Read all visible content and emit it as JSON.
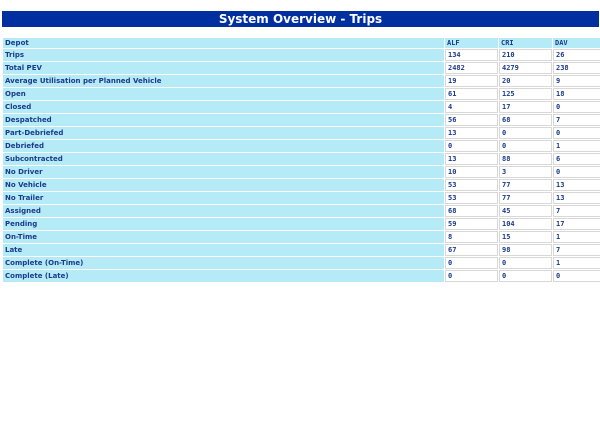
{
  "title": "System Overview - Trips",
  "header": {
    "label": "Depot",
    "columns": [
      "ALF",
      "CRI",
      "DAV"
    ]
  },
  "rows": [
    {
      "label": "Trips",
      "values": [
        "134",
        "210",
        "26"
      ]
    },
    {
      "label": "Total PEV",
      "values": [
        "2482",
        "4279",
        "238"
      ]
    },
    {
      "label": "Average Utilisation per Planned Vehicle",
      "values": [
        "19",
        "20",
        "9"
      ]
    },
    {
      "label": "Open",
      "values": [
        "61",
        "125",
        "18"
      ]
    },
    {
      "label": "Closed",
      "values": [
        "4",
        "17",
        "0"
      ]
    },
    {
      "label": "Despatched",
      "values": [
        "56",
        "68",
        "7"
      ]
    },
    {
      "label": "Part-Debriefed",
      "values": [
        "13",
        "0",
        "0"
      ]
    },
    {
      "label": "Debriefed",
      "values": [
        "0",
        "0",
        "1"
      ]
    },
    {
      "label": "Subcontracted",
      "values": [
        "13",
        "88",
        "6"
      ]
    },
    {
      "label": "No Driver",
      "values": [
        "10",
        "3",
        "0"
      ]
    },
    {
      "label": "No Vehicle",
      "values": [
        "53",
        "77",
        "13"
      ]
    },
    {
      "label": "No Trailer",
      "values": [
        "53",
        "77",
        "13"
      ]
    },
    {
      "label": "Assigned",
      "values": [
        "68",
        "45",
        "7"
      ]
    },
    {
      "label": "Pending",
      "values": [
        "59",
        "104",
        "17"
      ]
    },
    {
      "label": "On-Time",
      "values": [
        "8",
        "15",
        "1"
      ]
    },
    {
      "label": "Late",
      "values": [
        "67",
        "98",
        "7"
      ]
    },
    {
      "label": "Complete (On-Time)",
      "values": [
        "0",
        "0",
        "1"
      ]
    },
    {
      "label": "Complete (Late)",
      "values": [
        "0",
        "0",
        "0"
      ]
    }
  ],
  "colors": {
    "title_bg": "#002f9f",
    "label_bg": "#b5ebf7",
    "text": "#1a3a8c"
  }
}
